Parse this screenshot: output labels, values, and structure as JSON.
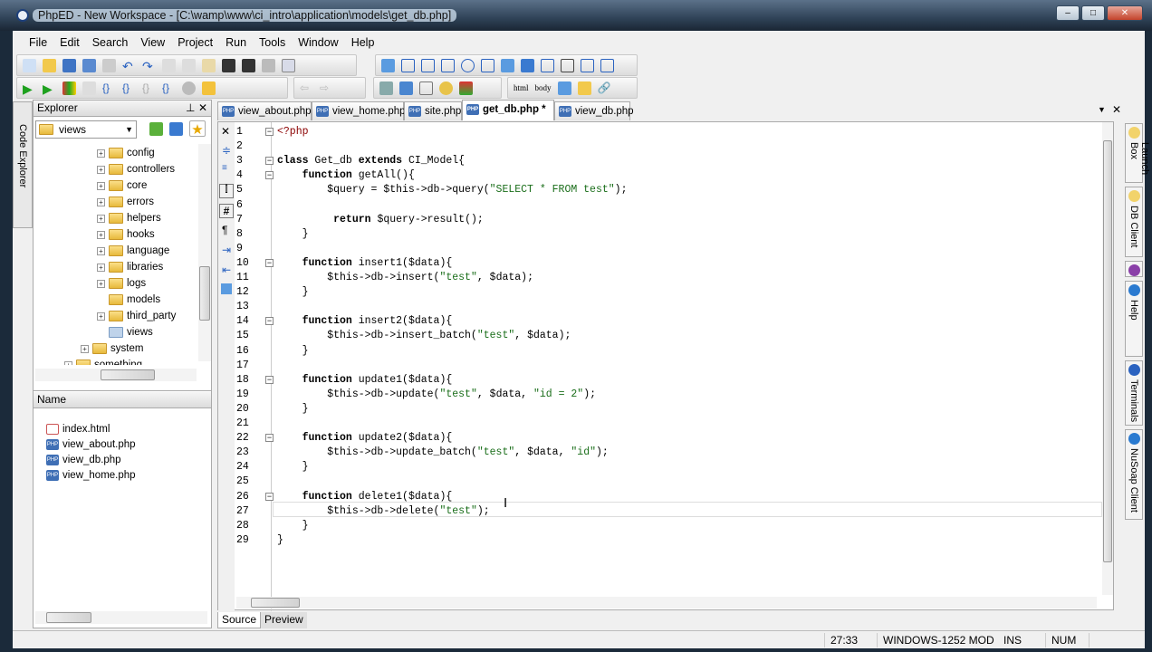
{
  "window": {
    "title": "PhpED - New Workspace - [C:\\wamp\\www\\ci_intro\\application\\models\\get_db.php]",
    "min": "–",
    "max": "□",
    "close": "✕"
  },
  "menu": [
    "File",
    "Edit",
    "Search",
    "View",
    "Project",
    "Run",
    "Tools",
    "Window",
    "Help"
  ],
  "toolbar": {
    "html": "html",
    "body": "body"
  },
  "explorer": {
    "title": "Explorer",
    "pin": "⊥",
    "close": "✕",
    "side_tab": "Code Explorer",
    "folder_select": "views",
    "tree": [
      {
        "label": "config",
        "exp": "+"
      },
      {
        "label": "controllers",
        "exp": "+"
      },
      {
        "label": "core",
        "exp": "+"
      },
      {
        "label": "errors",
        "exp": "+"
      },
      {
        "label": "helpers",
        "exp": "+"
      },
      {
        "label": "hooks",
        "exp": "+"
      },
      {
        "label": "language",
        "exp": "+"
      },
      {
        "label": "libraries",
        "exp": "+"
      },
      {
        "label": "logs",
        "exp": "+"
      },
      {
        "label": "models",
        "exp": ""
      },
      {
        "label": "third_party",
        "exp": "+"
      },
      {
        "label": "views",
        "exp": ""
      }
    ],
    "system": "system",
    "something": "something",
    "list_header": "Name",
    "files": [
      "index.html",
      "view_about.php",
      "view_db.php",
      "view_home.php"
    ]
  },
  "tabs": [
    "view_about.php",
    "view_home.php",
    "site.php",
    "get_db.php *",
    "view_db.php"
  ],
  "code": [
    "<?php",
    "",
    "class Get_db extends CI_Model{",
    "    function getAll(){",
    "        $query = $this->db->query(\"SELECT * FROM test\");",
    "",
    "         return $query->result();",
    "    }",
    "",
    "    function insert1($data){",
    "        $this->db->insert(\"test\", $data);",
    "    }",
    "",
    "    function insert2($data){",
    "        $this->db->insert_batch(\"test\", $data);",
    "    }",
    "",
    "    function update1($data){",
    "        $this->db->update(\"test\", $data, \"id = 2\");",
    "    }",
    "",
    "    function update2($data){",
    "        $this->db->update_batch(\"test\", $data, \"id\");",
    "    }",
    "",
    "    function delete1($data){",
    "        $this->db->delete(\"test\");",
    "    }",
    "}"
  ],
  "folds": [
    1,
    3,
    4,
    10,
    14,
    18,
    22,
    26
  ],
  "bottom_tabs": {
    "source": "Source",
    "preview": "Preview"
  },
  "status": {
    "pos": "27:33",
    "encoding": "WINDOWS-1252 MOD",
    "ins": "INS",
    "num": "NUM"
  },
  "right_panels": [
    "Launch Box",
    "DB Client",
    "Help",
    "Terminals",
    "NuSoap Client"
  ]
}
